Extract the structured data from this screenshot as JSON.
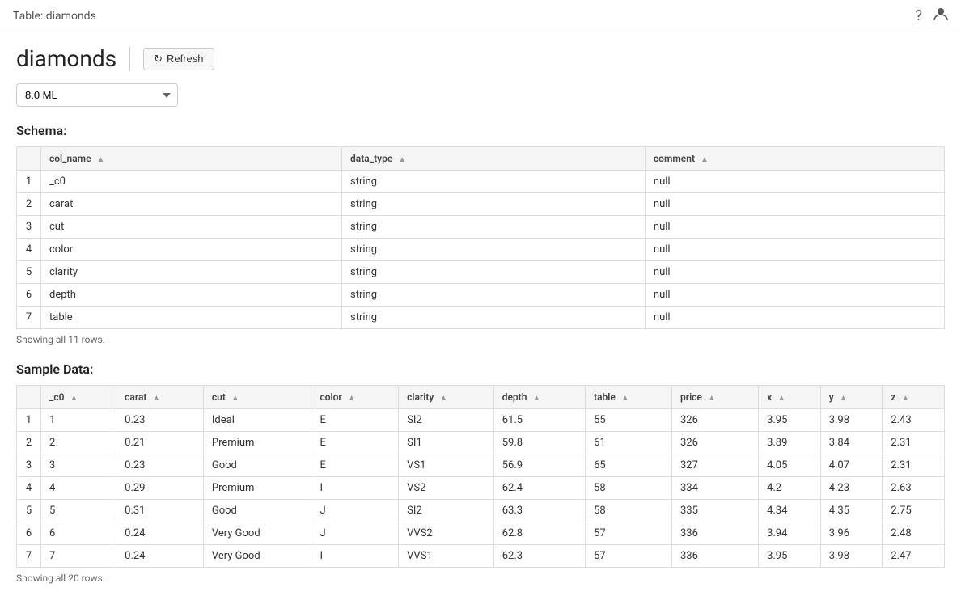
{
  "topbar": {
    "title": "Table: diamonds",
    "help_icon": "?",
    "user_icon": "👤"
  },
  "header": {
    "title": "diamonds",
    "refresh_label": "Refresh"
  },
  "dropdown": {
    "value": "8.0 ML",
    "options": [
      "8.0 ML"
    ]
  },
  "schema_section": {
    "title": "Schema:",
    "showing": "Showing all 11 rows.",
    "columns": [
      {
        "key": "row_num",
        "label": ""
      },
      {
        "key": "col_name",
        "label": "col_name"
      },
      {
        "key": "data_type",
        "label": "data_type"
      },
      {
        "key": "comment",
        "label": "comment"
      }
    ],
    "rows": [
      {
        "row_num": "1",
        "col_name": "_c0",
        "data_type": "string",
        "comment": "null"
      },
      {
        "row_num": "2",
        "col_name": "carat",
        "data_type": "string",
        "comment": "null"
      },
      {
        "row_num": "3",
        "col_name": "cut",
        "data_type": "string",
        "comment": "null"
      },
      {
        "row_num": "4",
        "col_name": "color",
        "data_type": "string",
        "comment": "null"
      },
      {
        "row_num": "5",
        "col_name": "clarity",
        "data_type": "string",
        "comment": "null"
      },
      {
        "row_num": "6",
        "col_name": "depth",
        "data_type": "string",
        "comment": "null"
      },
      {
        "row_num": "7",
        "col_name": "table",
        "data_type": "string",
        "comment": "null"
      }
    ]
  },
  "sample_section": {
    "title": "Sample Data:",
    "showing": "Showing all 20 rows.",
    "columns": [
      {
        "key": "row_num",
        "label": ""
      },
      {
        "key": "_c0",
        "label": "_c0"
      },
      {
        "key": "carat",
        "label": "carat"
      },
      {
        "key": "cut",
        "label": "cut"
      },
      {
        "key": "color",
        "label": "color"
      },
      {
        "key": "clarity",
        "label": "clarity"
      },
      {
        "key": "depth",
        "label": "depth"
      },
      {
        "key": "table",
        "label": "table"
      },
      {
        "key": "price",
        "label": "price"
      },
      {
        "key": "x",
        "label": "x"
      },
      {
        "key": "y",
        "label": "y"
      },
      {
        "key": "z",
        "label": "z"
      }
    ],
    "rows": [
      {
        "row_num": "1",
        "_c0": "1",
        "carat": "0.23",
        "cut": "Ideal",
        "color": "E",
        "clarity": "SI2",
        "depth": "61.5",
        "table": "55",
        "price": "326",
        "x": "3.95",
        "y": "3.98",
        "z": "2.43"
      },
      {
        "row_num": "2",
        "_c0": "2",
        "carat": "0.21",
        "cut": "Premium",
        "color": "E",
        "clarity": "SI1",
        "depth": "59.8",
        "table": "61",
        "price": "326",
        "x": "3.89",
        "y": "3.84",
        "z": "2.31"
      },
      {
        "row_num": "3",
        "_c0": "3",
        "carat": "0.23",
        "cut": "Good",
        "color": "E",
        "clarity": "VS1",
        "depth": "56.9",
        "table": "65",
        "price": "327",
        "x": "4.05",
        "y": "4.07",
        "z": "2.31"
      },
      {
        "row_num": "4",
        "_c0": "4",
        "carat": "0.29",
        "cut": "Premium",
        "color": "I",
        "clarity": "VS2",
        "depth": "62.4",
        "table": "58",
        "price": "334",
        "x": "4.2",
        "y": "4.23",
        "z": "2.63"
      },
      {
        "row_num": "5",
        "_c0": "5",
        "carat": "0.31",
        "cut": "Good",
        "color": "J",
        "clarity": "SI2",
        "depth": "63.3",
        "table": "58",
        "price": "335",
        "x": "4.34",
        "y": "4.35",
        "z": "2.75"
      },
      {
        "row_num": "6",
        "_c0": "6",
        "carat": "0.24",
        "cut": "Very Good",
        "color": "J",
        "clarity": "VVS2",
        "depth": "62.8",
        "table": "57",
        "price": "336",
        "x": "3.94",
        "y": "3.96",
        "z": "2.48"
      },
      {
        "row_num": "7",
        "_c0": "7",
        "carat": "0.24",
        "cut": "Very Good",
        "color": "I",
        "clarity": "VVS1",
        "depth": "62.3",
        "table": "57",
        "price": "336",
        "x": "3.95",
        "y": "3.98",
        "z": "2.47"
      }
    ]
  }
}
